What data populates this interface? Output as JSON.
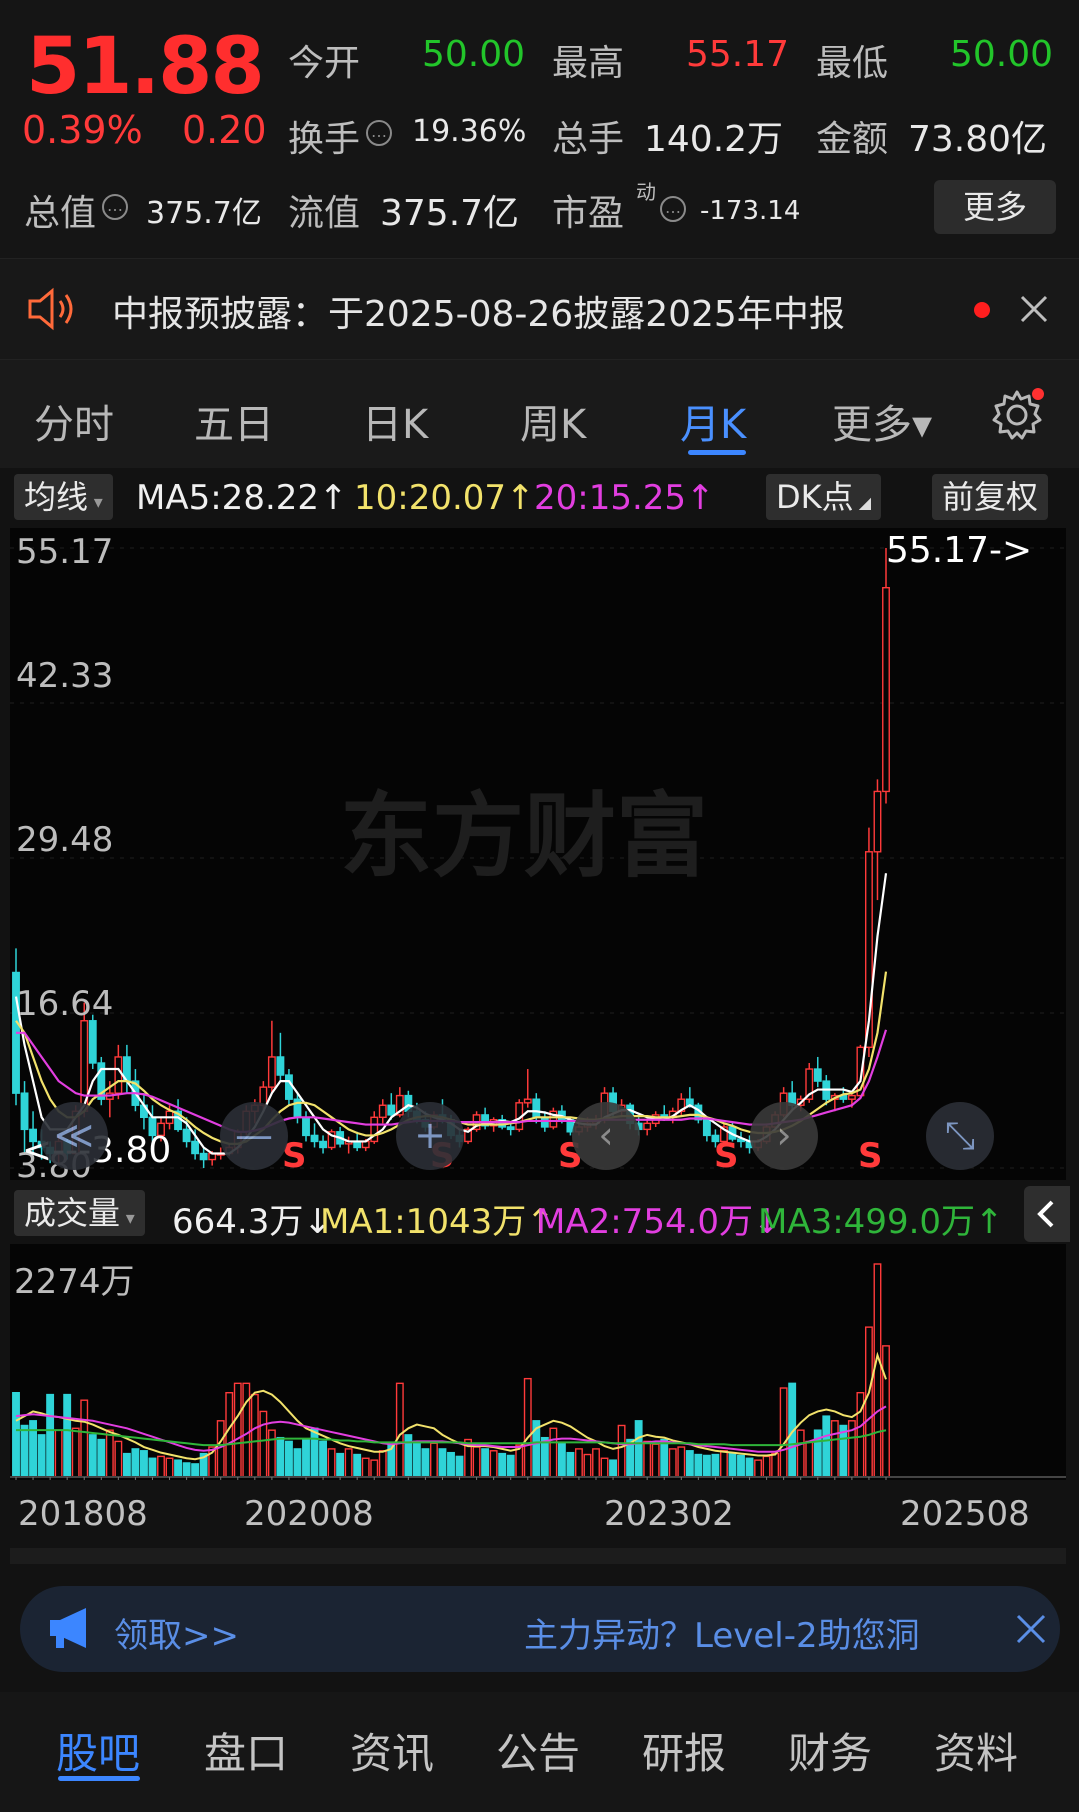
{
  "header": {
    "price": "51.88",
    "change_pct": "0.39%",
    "change_amt": "0.20",
    "open_label": "今开",
    "open_value": "50.00",
    "high_label": "最高",
    "high_value": "55.17",
    "low_label": "最低",
    "low_value": "50.00",
    "turnover_label": "换手",
    "turnover_value": "19.36%",
    "volume_label": "总手",
    "volume_value": "140.2万",
    "amount_label": "金额",
    "amount_value": "73.80亿",
    "mktcap_label": "总值",
    "mktcap_value": "375.7亿",
    "float_label": "流值",
    "float_value": "375.7亿",
    "pe_label": "市盈",
    "pe_sup": "动",
    "pe_value": "-173.14",
    "more_label": "更多"
  },
  "notice": {
    "text": "中报预披露：于2025-08-26披露2025年中报"
  },
  "tabs": [
    {
      "label": "分时"
    },
    {
      "label": "五日"
    },
    {
      "label": "日K"
    },
    {
      "label": "周K"
    },
    {
      "label": "月K"
    },
    {
      "label": "更多▾"
    }
  ],
  "ma_bar": {
    "selector": "均线",
    "ma5": "MA5:28.22",
    "ma10": "10:20.07",
    "ma20": "20:15.25",
    "arrow_up": "↑",
    "dk": "DK点",
    "adjust": "前复权"
  },
  "price_axis": {
    "top": "55.17",
    "l2": "42.33",
    "l3": "29.48",
    "l4": "16.64",
    "bottom": "3.80",
    "high_marker": "55.17->",
    "low_marker": "<---3.80"
  },
  "watermark": "东方财富",
  "s_marks": [
    "S",
    "S",
    "S",
    "S",
    "S",
    "S"
  ],
  "controls": {
    "rewind": "≪",
    "zoom_out": "—",
    "zoom_in": "+",
    "prev": "‹",
    "next": "›",
    "fullscreen": "⤡"
  },
  "volume_bar": {
    "selector": "成交量",
    "current": "664.3万",
    "down": "↓",
    "up": "↑",
    "ma1": "MA1:1043万",
    "ma2": "MA2:754.0万",
    "ma3": "MA3:499.0万",
    "axis_top": "2274万"
  },
  "dates": [
    "201808",
    "202008",
    "202302",
    "202508"
  ],
  "ad": {
    "left": "领取>>",
    "right": "主力异动？Level-2助您洞"
  },
  "bottom_nav": [
    {
      "label": "股吧"
    },
    {
      "label": "盘口"
    },
    {
      "label": "资讯"
    },
    {
      "label": "公告"
    },
    {
      "label": "研报"
    },
    {
      "label": "财务"
    },
    {
      "label": "资料"
    }
  ],
  "colors": {
    "up": "#ff3a3a",
    "down": "#2fd4d8",
    "ma5": "#ffffff",
    "ma10": "#f2e26b",
    "ma20": "#e23ee0",
    "ma3": "#2fb53a",
    "accent": "#3c86ff"
  },
  "chart_data": {
    "type": "candlestick",
    "y_range": [
      3.8,
      55.17
    ],
    "y_ticks": [
      55.17,
      42.33,
      29.48,
      16.64,
      3.8
    ],
    "x_labels": [
      "201808",
      "202008",
      "202302",
      "202508"
    ],
    "candles": [
      [
        20,
        22,
        9,
        10
      ],
      [
        10,
        11,
        5,
        7
      ],
      [
        7,
        8.5,
        5,
        6
      ],
      [
        6,
        7,
        4.5,
        5.5
      ],
      [
        5.5,
        6,
        4.2,
        5
      ],
      [
        5,
        6.5,
        4,
        6
      ],
      [
        6,
        6.2,
        4.5,
        5
      ],
      [
        5,
        9,
        4.8,
        8.5
      ],
      [
        8.5,
        17.5,
        8,
        16
      ],
      [
        16,
        16.5,
        12,
        12.5
      ],
      [
        12.5,
        13,
        9,
        9.5
      ],
      [
        9.5,
        11,
        8,
        10
      ],
      [
        10,
        14,
        9.5,
        13
      ],
      [
        13,
        14,
        10,
        11
      ],
      [
        11,
        12,
        8.5,
        9
      ],
      [
        9,
        10,
        7,
        8
      ],
      [
        8,
        9,
        6,
        6.5
      ],
      [
        6.5,
        8,
        6,
        7.5
      ],
      [
        7.5,
        9,
        7,
        8.5
      ],
      [
        8.5,
        9.5,
        6.8,
        7
      ],
      [
        7,
        8,
        5.5,
        6
      ],
      [
        6,
        7,
        4.5,
        5
      ],
      [
        5,
        5.5,
        3.8,
        4.5
      ],
      [
        4.5,
        5.2,
        4,
        5
      ],
      [
        5,
        5.5,
        4.5,
        5
      ],
      [
        5,
        5.8,
        4.8,
        5.5
      ],
      [
        5.5,
        7,
        5,
        6.8
      ],
      [
        6.8,
        9,
        6.5,
        8.5
      ],
      [
        8.5,
        9.5,
        7.5,
        9
      ],
      [
        9,
        11,
        8.5,
        10.5
      ],
      [
        10.5,
        16,
        10,
        13
      ],
      [
        13,
        15,
        11,
        11.5
      ],
      [
        11.5,
        12,
        9,
        9.5
      ],
      [
        9.5,
        10,
        7.5,
        8
      ],
      [
        8,
        8.5,
        6,
        6.5
      ],
      [
        6.5,
        7.5,
        5.5,
        6
      ],
      [
        6,
        6.5,
        5,
        5.5
      ],
      [
        5.5,
        7,
        5.3,
        6.8
      ],
      [
        6.8,
        7.2,
        5.5,
        5.8
      ],
      [
        5.8,
        6.4,
        5,
        6
      ],
      [
        6,
        6.8,
        5.2,
        5.5
      ],
      [
        5.5,
        6.2,
        5.2,
        6
      ],
      [
        6,
        8.5,
        5.8,
        8
      ],
      [
        8,
        9.5,
        7.5,
        9
      ],
      [
        9,
        10,
        7.8,
        8.2
      ],
      [
        8.2,
        10.5,
        8,
        9.8
      ],
      [
        9.8,
        10.2,
        8,
        8.5
      ],
      [
        8.5,
        9.2,
        7.5,
        7.8
      ],
      [
        7.8,
        8.5,
        6.8,
        7.2
      ],
      [
        7.2,
        8.5,
        7,
        8.2
      ],
      [
        8.2,
        9.5,
        7.5,
        7.8
      ],
      [
        7.8,
        8.2,
        6.2,
        6.5
      ],
      [
        6.5,
        7,
        5.5,
        6
      ],
      [
        6,
        7.2,
        5.8,
        7
      ],
      [
        7,
        8.5,
        6.8,
        8.2
      ],
      [
        8.2,
        8.8,
        7,
        7.3
      ],
      [
        7.3,
        8,
        6.8,
        7.8
      ],
      [
        7.8,
        8.2,
        7,
        7.2
      ],
      [
        7.2,
        7.6,
        6.5,
        7
      ],
      [
        7,
        9.5,
        6.8,
        9.2
      ],
      [
        9.2,
        12,
        8.8,
        9.5
      ],
      [
        9.5,
        10,
        7.5,
        8
      ],
      [
        8,
        8.5,
        6.8,
        7.2
      ],
      [
        7.2,
        8.8,
        7,
        8.5
      ],
      [
        8.5,
        9,
        7.5,
        7.8
      ],
      [
        7.8,
        8,
        6.5,
        6.8
      ],
      [
        6.8,
        7.5,
        6.5,
        7.2
      ],
      [
        7.2,
        8,
        6.8,
        7.5
      ],
      [
        7.5,
        8.2,
        7,
        7.8
      ],
      [
        7.8,
        10.5,
        7.5,
        10
      ],
      [
        10,
        10.5,
        8,
        8.5
      ],
      [
        8.5,
        9.5,
        8,
        9
      ],
      [
        9,
        9.2,
        7,
        7.5
      ],
      [
        7.5,
        8,
        6.5,
        7
      ],
      [
        7,
        7.8,
        6.5,
        7.5
      ],
      [
        7.5,
        8.5,
        7.2,
        8.2
      ],
      [
        8.2,
        9,
        7.8,
        8
      ],
      [
        8,
        8.8,
        7.5,
        8.5
      ],
      [
        8.5,
        10,
        8.2,
        9.5
      ],
      [
        9.5,
        10.5,
        8.8,
        9
      ],
      [
        9,
        9.2,
        7.5,
        7.8
      ],
      [
        7.8,
        8,
        6,
        6.5
      ],
      [
        6.5,
        7,
        5.5,
        6
      ],
      [
        6,
        7.5,
        5.8,
        7.2
      ],
      [
        7.2,
        7.6,
        6,
        6.2
      ],
      [
        6.2,
        6.8,
        5.5,
        6
      ],
      [
        6,
        6.5,
        5,
        5.5
      ],
      [
        5.5,
        6.2,
        5.2,
        6
      ],
      [
        6,
        7.5,
        5.8,
        7.2
      ],
      [
        7.2,
        8.5,
        7,
        8.2
      ],
      [
        8.2,
        10.5,
        8,
        10
      ],
      [
        10,
        11,
        8.5,
        9
      ],
      [
        9,
        9.8,
        8.5,
        9.5
      ],
      [
        9.5,
        12.5,
        9.2,
        12
      ],
      [
        12,
        13,
        10.5,
        11
      ],
      [
        11,
        11.5,
        9,
        9.5
      ],
      [
        9.5,
        10,
        8.5,
        9.8
      ],
      [
        9.8,
        10.5,
        9.2,
        9.5
      ],
      [
        9.5,
        10,
        8.8,
        9.8
      ],
      [
        9.8,
        14,
        9.5,
        13.8
      ],
      [
        13.8,
        32,
        13,
        30
      ],
      [
        30,
        36,
        26,
        35
      ],
      [
        35,
        55.17,
        34,
        51.88
      ]
    ],
    "ma5": [
      18,
      14,
      11,
      8,
      7,
      7,
      7,
      8,
      9,
      11,
      12,
      12,
      12,
      11,
      10,
      9,
      8,
      8,
      8,
      8,
      7.5,
      6.5,
      5.5,
      5,
      5,
      5,
      5.5,
      6.3,
      7.2,
      8.5,
      10,
      11,
      11,
      10,
      9,
      8,
      7,
      6.5,
      6.3,
      6,
      6,
      6,
      6.5,
      7,
      8,
      8.5,
      9,
      8.8,
      8.3,
      8,
      7.8,
      7.5,
      7,
      6.8,
      7.3,
      7.5,
      7.6,
      7.7,
      7.6,
      7.9,
      8.5,
      8.5,
      8.4,
      8.2,
      8.1,
      7.8,
      7.5,
      7.4,
      7.4,
      8,
      8.3,
      8.6,
      8.6,
      8.3,
      8,
      7.9,
      7.8,
      8.1,
      8.6,
      9,
      8.6,
      8,
      7.5,
      7,
      6.6,
      6.3,
      6,
      6,
      6.4,
      7,
      7.8,
      8.6,
      9.2,
      9.9,
      10.3,
      10.3,
      10.3,
      10.3,
      10.1,
      11,
      16,
      23,
      28.22
    ],
    "ma10": [
      16,
      15,
      13,
      11,
      9.5,
      8.5,
      8,
      8,
      8.5,
      9.5,
      10,
      10.5,
      11,
      11,
      10.8,
      10.2,
      9.5,
      9,
      8.6,
      8.3,
      7.8,
      7.2,
      6.7,
      6.3,
      6,
      5.8,
      5.8,
      6,
      6.5,
      7,
      7.8,
      8.5,
      9,
      9.2,
      9.2,
      9,
      8.5,
      8,
      7.5,
      7,
      6.7,
      6.5,
      6.5,
      6.7,
      7,
      7.4,
      7.8,
      8,
      8.1,
      8.1,
      8,
      7.8,
      7.6,
      7.4,
      7.4,
      7.4,
      7.4,
      7.4,
      7.5,
      7.6,
      7.8,
      8,
      8,
      8,
      8,
      8,
      7.9,
      7.8,
      7.8,
      7.9,
      8,
      8.1,
      8.1,
      8.1,
      8.1,
      8,
      8,
      8,
      8.1,
      8.2,
      8.2,
      8,
      7.8,
      7.5,
      7.3,
      7,
      6.8,
      6.7,
      6.7,
      6.8,
      7,
      7.3,
      7.7,
      8.2,
      8.7,
      9.2,
      9.6,
      9.9,
      10,
      10.3,
      12,
      15,
      20.07
    ],
    "ma20": [
      15,
      15,
      14,
      13,
      12,
      11,
      10.5,
      10,
      9.8,
      9.8,
      9.8,
      9.8,
      9.9,
      10,
      10,
      9.9,
      9.7,
      9.4,
      9.1,
      8.8,
      8.5,
      8.2,
      7.9,
      7.6,
      7.3,
      7,
      6.8,
      6.8,
      6.9,
      7.1,
      7.4,
      7.7,
      7.9,
      8,
      8,
      8,
      7.9,
      7.8,
      7.7,
      7.6,
      7.5,
      7.4,
      7.4,
      7.4,
      7.4,
      7.5,
      7.6,
      7.7,
      7.7,
      7.7,
      7.7,
      7.7,
      7.6,
      7.6,
      7.6,
      7.6,
      7.6,
      7.6,
      7.6,
      7.6,
      7.7,
      7.7,
      7.7,
      7.7,
      7.7,
      7.7,
      7.7,
      7.7,
      7.7,
      7.8,
      7.8,
      7.8,
      7.8,
      7.8,
      7.8,
      7.8,
      7.8,
      7.8,
      7.8,
      7.9,
      7.9,
      7.9,
      7.8,
      7.7,
      7.6,
      7.5,
      7.4,
      7.4,
      7.4,
      7.5,
      7.6,
      7.7,
      7.8,
      8,
      8.2,
      8.4,
      8.6,
      8.8,
      9,
      9.6,
      11,
      13,
      15.25
    ],
    "volume_axis_max": 2274,
    "volume": [
      900,
      550,
      600,
      450,
      880,
      500,
      880,
      520,
      820,
      450,
      400,
      500,
      380,
      250,
      300,
      280,
      200,
      220,
      200,
      180,
      150,
      140,
      250,
      320,
      600,
      900,
      1000,
      1000,
      880,
      700,
      500,
      420,
      380,
      300,
      400,
      520,
      380,
      300,
      250,
      300,
      240,
      200,
      180,
      280,
      340,
      1000,
      450,
      380,
      300,
      360,
      300,
      260,
      220,
      400,
      320,
      300,
      280,
      250,
      230,
      340,
      1050,
      600,
      420,
      520,
      360,
      260,
      300,
      240,
      300,
      200,
      180,
      550,
      400,
      600,
      380,
      350,
      400,
      300,
      320,
      280,
      240,
      230,
      240,
      280,
      250,
      230,
      200,
      180,
      220,
      250,
      950,
      1000,
      500,
      380,
      500,
      650,
      600,
      550,
      600,
      900,
      1600,
      2274,
      1400
    ],
    "vol_ma1": [
      600,
      650,
      700,
      680,
      650,
      640,
      620,
      600,
      590,
      560,
      520,
      480,
      450,
      410,
      370,
      320,
      290,
      260,
      240,
      220,
      200,
      190,
      210,
      260,
      380,
      520,
      650,
      800,
      900,
      920,
      880,
      800,
      700,
      600,
      520,
      480,
      440,
      400,
      360,
      330,
      310,
      290,
      270,
      270,
      300,
      450,
      520,
      560,
      540,
      520,
      450,
      400,
      360,
      330,
      330,
      330,
      320,
      300,
      280,
      300,
      420,
      520,
      560,
      600,
      580,
      540,
      480,
      420,
      380,
      330,
      300,
      320,
      360,
      420,
      450,
      430,
      420,
      390,
      370,
      350,
      320,
      300,
      280,
      270,
      260,
      250,
      240,
      230,
      230,
      240,
      350,
      480,
      580,
      660,
      700,
      720,
      700,
      660,
      640,
      700,
      900,
      1300,
      1043
    ],
    "vol_ma2": [
      650,
      660,
      670,
      660,
      650,
      640,
      630,
      620,
      610,
      600,
      580,
      560,
      540,
      520,
      490,
      460,
      430,
      400,
      370,
      340,
      310,
      290,
      280,
      290,
      320,
      360,
      410,
      460,
      520,
      560,
      580,
      590,
      580,
      560,
      540,
      520,
      500,
      480,
      460,
      440,
      420,
      400,
      380,
      360,
      350,
      360,
      370,
      380,
      380,
      380,
      380,
      370,
      360,
      350,
      340,
      340,
      330,
      320,
      320,
      320,
      340,
      360,
      380,
      400,
      410,
      410,
      400,
      390,
      380,
      370,
      360,
      350,
      350,
      360,
      370,
      380,
      380,
      370,
      360,
      350,
      340,
      330,
      320,
      310,
      300,
      290,
      280,
      270,
      270,
      270,
      290,
      320,
      350,
      380,
      410,
      440,
      460,
      480,
      500,
      540,
      620,
      700,
      754
    ],
    "vol_ma3": [
      500,
      500,
      500,
      500,
      500,
      500,
      500,
      490,
      480,
      470,
      460,
      450,
      440,
      430,
      420,
      410,
      400,
      390,
      380,
      370,
      360,
      350,
      340,
      340,
      340,
      350,
      360,
      370,
      380,
      390,
      400,
      410,
      410,
      410,
      410,
      410,
      400,
      400,
      390,
      390,
      380,
      380,
      370,
      370,
      370,
      370,
      370,
      370,
      370,
      370,
      370,
      370,
      370,
      360,
      360,
      360,
      360,
      360,
      360,
      360,
      360,
      370,
      370,
      370,
      370,
      370,
      370,
      370,
      370,
      370,
      360,
      360,
      360,
      360,
      360,
      360,
      360,
      360,
      360,
      360,
      350,
      350,
      350,
      350,
      340,
      340,
      340,
      340,
      340,
      340,
      340,
      350,
      360,
      370,
      380,
      390,
      400,
      410,
      420,
      430,
      450,
      480,
      499
    ]
  }
}
